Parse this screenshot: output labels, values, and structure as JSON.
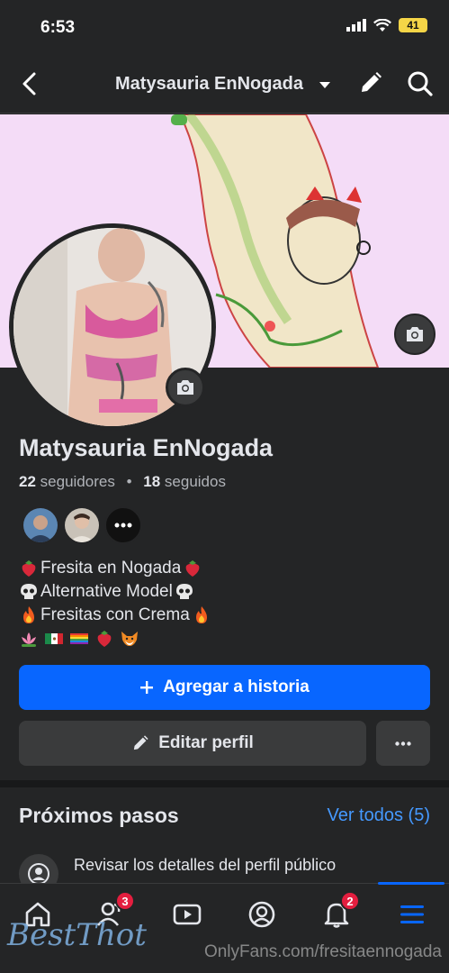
{
  "status_bar": {
    "time": "6:53",
    "battery": "41"
  },
  "nav": {
    "title": "Matysauria EnNogada"
  },
  "profile": {
    "name": "Matysauria EnNogada",
    "followers_count": "22",
    "followers_label": "seguidores",
    "separator": "•",
    "following_count": "18",
    "following_label": "seguidos"
  },
  "bio": [
    {
      "pre_emoji": "strawberry",
      "text": "Fresita en Nogada",
      "post_emoji": "strawberry"
    },
    {
      "pre_emoji": "skull",
      "text": "Alternative Model",
      "post_emoji": "skull"
    },
    {
      "pre_emoji": "fire",
      "text": "Fresitas con Crema",
      "post_emoji": "fire"
    }
  ],
  "bio_emoji_row": [
    "lotus",
    "mexico-flag",
    "rainbow-flag",
    "strawberry",
    "fox"
  ],
  "actions": {
    "add_story": "Agregar a historia",
    "edit_profile": "Editar perfil"
  },
  "next_steps": {
    "title": "Próximos pasos",
    "see_all": "Ver todos (5)",
    "item": "Revisar los detalles del perfil público"
  },
  "tabs": [
    {
      "name": "home",
      "badge": ""
    },
    {
      "name": "friends",
      "badge": "3"
    },
    {
      "name": "video",
      "badge": ""
    },
    {
      "name": "profile",
      "badge": ""
    },
    {
      "name": "notifications",
      "badge": "2"
    },
    {
      "name": "menu",
      "badge": ""
    }
  ],
  "watermark": {
    "logo": "BestThot",
    "source": "OnlyFans.com/fresitaennogada"
  },
  "colors": {
    "accent": "#0866ff",
    "link": "#4599ff",
    "badge": "#e41e3f",
    "background": "#242526"
  }
}
